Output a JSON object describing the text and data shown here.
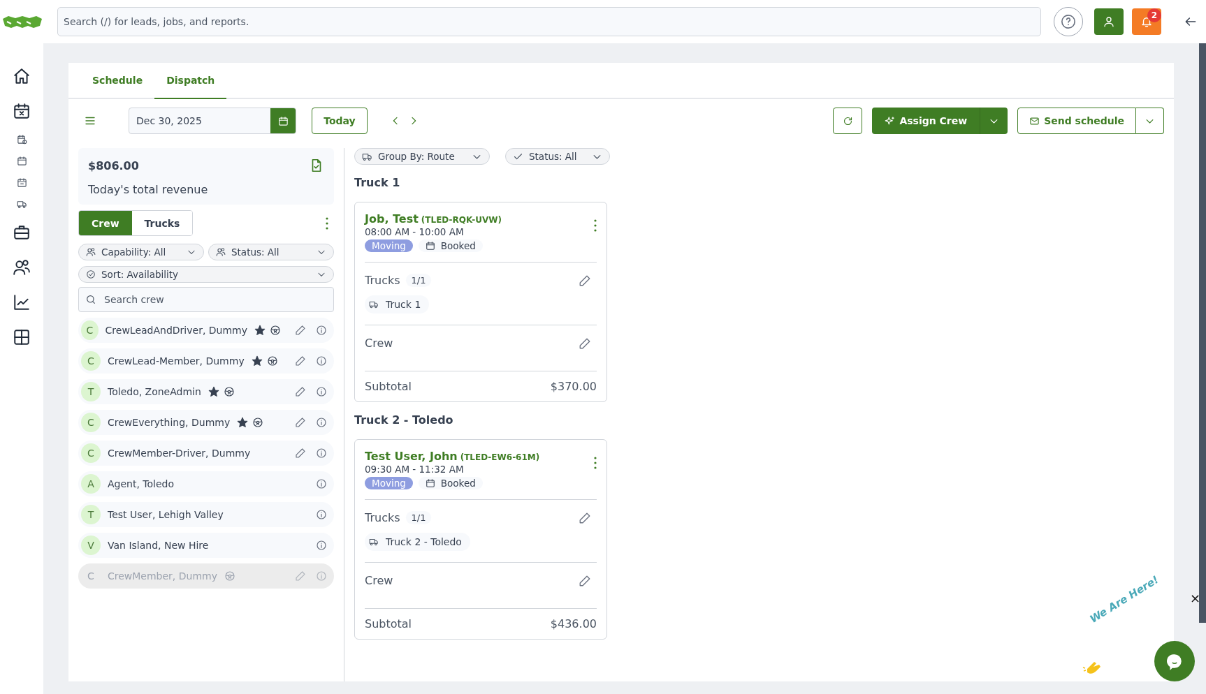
{
  "topbar": {
    "search_placeholder": "Search (/) for leads, jobs, and reports.",
    "notification_count": "2"
  },
  "tabs": [
    {
      "label": "Schedule",
      "selected": false
    },
    {
      "label": "Dispatch",
      "selected": true
    }
  ],
  "toolbar": {
    "date": "Dec 30, 2025",
    "today": "Today",
    "assign": "Assign Crew",
    "send": "Send schedule"
  },
  "revenue": {
    "amount": "$806.00",
    "label": "Today's total revenue"
  },
  "view_toggle": [
    {
      "label": "Crew",
      "selected": true
    },
    {
      "label": "Trucks",
      "selected": false
    }
  ],
  "crew_filters": [
    {
      "label": "Capability: All",
      "kind": "people"
    },
    {
      "label": "Status: All",
      "kind": "people"
    },
    {
      "label": "Sort: Availability",
      "kind": "check"
    }
  ],
  "crew_search": {
    "placeholder": "Search crew"
  },
  "crew": [
    {
      "initial": "C",
      "name": "CrewLeadAndDriver, Dummy",
      "lead": true,
      "driver": true,
      "editable": true,
      "disabled": false
    },
    {
      "initial": "C",
      "name": "CrewLead-Member, Dummy",
      "lead": true,
      "driver": true,
      "editable": true,
      "disabled": false
    },
    {
      "initial": "T",
      "name": "Toledo, ZoneAdmin",
      "lead": true,
      "driver": true,
      "editable": true,
      "disabled": false
    },
    {
      "initial": "C",
      "name": "CrewEverything, Dummy",
      "lead": true,
      "driver": true,
      "editable": true,
      "disabled": false
    },
    {
      "initial": "C",
      "name": "CrewMember-Driver, Dummy",
      "lead": false,
      "driver": false,
      "editable": true,
      "disabled": false
    },
    {
      "initial": "A",
      "name": "Agent, Toledo",
      "lead": false,
      "driver": false,
      "editable": false,
      "disabled": false
    },
    {
      "initial": "T",
      "name": "Test User, Lehigh Valley",
      "lead": false,
      "driver": false,
      "editable": false,
      "disabled": false
    },
    {
      "initial": "V",
      "name": "Van Island, New Hire",
      "lead": false,
      "driver": false,
      "editable": false,
      "disabled": false
    },
    {
      "initial": "C",
      "name": "CrewMember, Dummy",
      "lead": false,
      "driver": true,
      "editable": true,
      "disabled": true
    }
  ],
  "route_filters": [
    {
      "label": "Group By: Route",
      "kind": "truck"
    },
    {
      "label": "Status: All",
      "kind": "check"
    }
  ],
  "groups": [
    {
      "title": "Truck 1",
      "jobs": [
        {
          "name": "Job, Test",
          "code": "(TLED-RQK-UVW)",
          "time": "08:00 AM - 10:00 AM",
          "type": "Moving",
          "status": "Booked",
          "trucks_label": "Trucks",
          "trucks_count": "1/1",
          "trucks": [
            "Truck 1"
          ],
          "crew_label": "Crew",
          "subtotal_label": "Subtotal",
          "subtotal": "$370.00"
        }
      ]
    },
    {
      "title": "Truck 2 - Toledo",
      "jobs": [
        {
          "name": "Test User, John",
          "code": "(TLED-EW6-61M)",
          "time": "09:30 AM - 11:32 AM",
          "type": "Moving",
          "status": "Booked",
          "trucks_label": "Trucks",
          "trucks_count": "1/1",
          "trucks": [
            "Truck 2 - Toledo"
          ],
          "crew_label": "Crew",
          "subtotal_label": "Subtotal",
          "subtotal": "$436.00"
        }
      ]
    }
  ],
  "chat": {
    "greeting": "We Are Here!",
    "close": "×"
  }
}
